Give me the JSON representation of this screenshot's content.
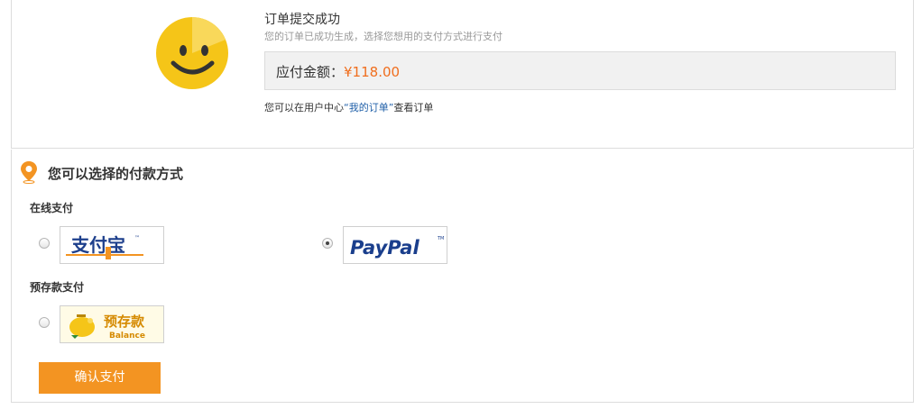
{
  "order": {
    "title": "订单提交成功",
    "subtitle": "您的订单已成功生成，选择您想用的支付方式进行支付",
    "amount_label": "应付金额：",
    "amount_value": "¥118.00",
    "link_prefix": "您可以在用户中心",
    "link_text": "“我的订单”",
    "link_suffix": "查看订单"
  },
  "payment": {
    "section_title": "您可以选择的付款方式",
    "online_label": "在线支付",
    "prepaid_label": "预存款支付",
    "options": [
      {
        "name": "alipay",
        "logo_text": "支付宝",
        "selected": false
      },
      {
        "name": "paypal",
        "logo_text": "PayPal",
        "selected": true
      },
      {
        "name": "balance",
        "logo_text": "预存款",
        "logo_subtext": "Balance",
        "selected": false
      }
    ],
    "confirm_label": "确认支付"
  },
  "colors": {
    "accent_orange": "#f39422",
    "amount_orange": "#f06e1e",
    "link_blue": "#1f5fa8",
    "smiley_yellow": "#f5c518"
  }
}
